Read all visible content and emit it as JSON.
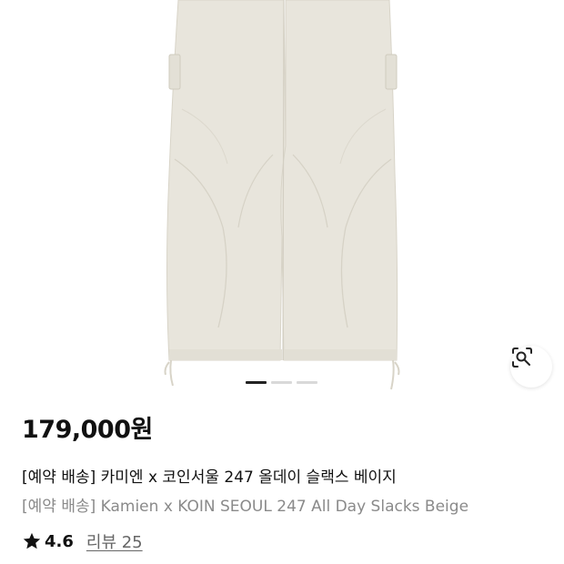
{
  "product": {
    "image_alt": "beige slacks",
    "price": "179,000원",
    "title_ko": "[예약 배송] 카미엔 x 코인서울 247 올데이 슬랙스 베이지",
    "title_en": "[예약 배송] Kamien x KOIN SEOUL 247 All Day Slacks Beige",
    "rating": "4.6",
    "review_label": "리뷰 25"
  },
  "gallery": {
    "total": 3,
    "active_index": 0
  },
  "icons": {
    "lens": "visual-search-icon",
    "star": "star-icon"
  },
  "colors": {
    "fabric": "#e8e5dc",
    "active_dot": "#222222",
    "inactive_dot": "#d9d9d9"
  }
}
